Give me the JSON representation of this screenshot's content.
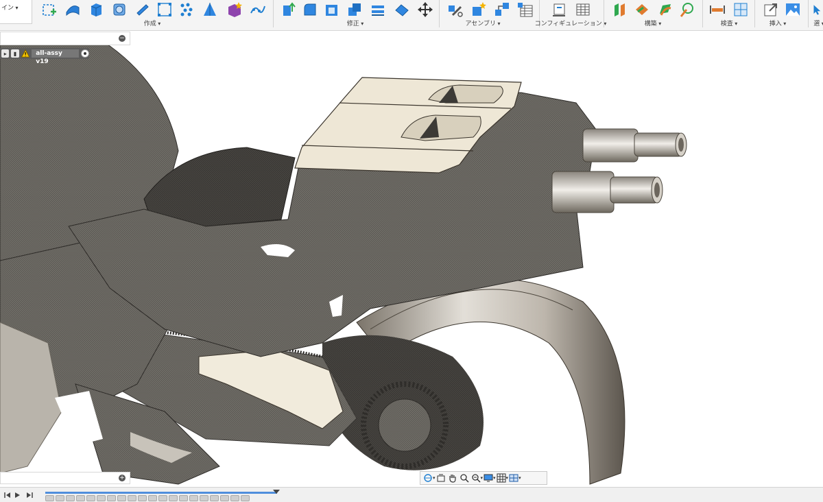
{
  "toolbar": {
    "design_menu_label": "イン",
    "groups": [
      {
        "id": "create",
        "label": "作成"
      },
      {
        "id": "modify",
        "label": "修正"
      },
      {
        "id": "assemble",
        "label": "アセンブリ"
      },
      {
        "id": "configure",
        "label": "コンフィギュレーション"
      },
      {
        "id": "construct",
        "label": "構築"
      },
      {
        "id": "inspect",
        "label": "検査"
      },
      {
        "id": "insert",
        "label": "挿入"
      }
    ],
    "right_cut_label": "選"
  },
  "browser": {
    "document_name": "all-assy v19"
  },
  "colors": {
    "toolbar_accent": "#1f7fd1",
    "warning": "#f5c400",
    "mesh_dark": "#575757",
    "body_cream": "#eee7d6",
    "timeline_track": "#4f8edc"
  },
  "icons": [
    "sketch-icon",
    "freeform-icon",
    "extrude-icon",
    "revolve-icon",
    "pipe-icon",
    "pattern-icon",
    "point-pattern-icon",
    "loft-icon",
    "new-component-icon",
    "spline-icon",
    "press-pull-icon",
    "fillet-icon",
    "shell-icon",
    "combine-icon",
    "split-icon",
    "draft-icon",
    "move-icon",
    "joint-icon",
    "new-component-star-icon",
    "as-built-joint-icon",
    "table-icon",
    "configure-icon",
    "config-table-icon",
    "offset-plane-icon",
    "plane-angle-icon",
    "tangent-plane-icon",
    "axis-icon",
    "measure-icon",
    "section-analysis-icon",
    "insert-mesh-icon",
    "canvas-icon"
  ],
  "navbar": {
    "items": [
      "orbit",
      "look-at",
      "pan",
      "zoom",
      "fit",
      "display-settings",
      "grid-settings",
      "viewports"
    ]
  },
  "timeline": {
    "feature_count": 20
  }
}
